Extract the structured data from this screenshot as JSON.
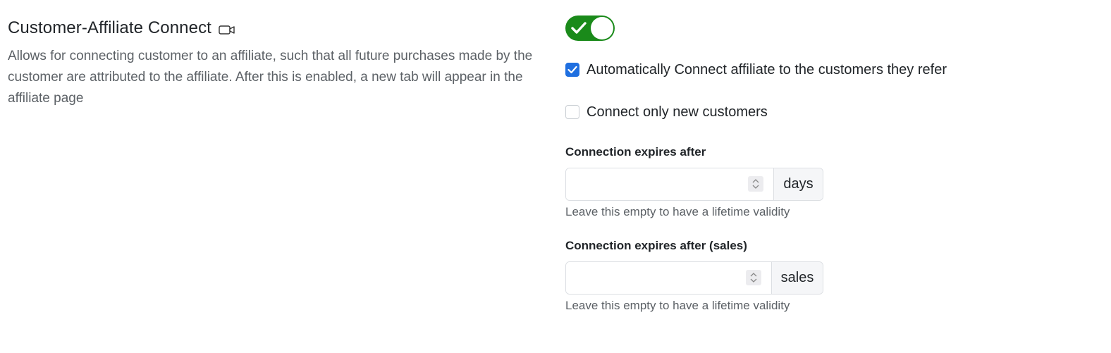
{
  "setting": {
    "title": "Customer-Affiliate Connect",
    "title_icon": "video-camera-icon",
    "description": "Allows for connecting customer to an affiliate, such that all future purchases made by the customer are attributed to the affiliate. After this is enabled, a new tab will appear in the affiliate page",
    "enabled": true
  },
  "options": {
    "auto_connect": {
      "label": "Automatically Connect affiliate to the customers they refer",
      "checked": true
    },
    "new_only": {
      "label": "Connect only new customers",
      "checked": false
    }
  },
  "expiry_days": {
    "label": "Connection expires after",
    "value": "",
    "suffix": "days",
    "help": "Leave this empty to have a lifetime validity"
  },
  "expiry_sales": {
    "label": "Connection expires after (sales)",
    "value": "",
    "suffix": "sales",
    "help": "Leave this empty to have a lifetime validity"
  },
  "colors": {
    "toggle_on": "#1a8a1a",
    "checkbox_on": "#1f6fe0",
    "muted_text": "#5c6166"
  }
}
